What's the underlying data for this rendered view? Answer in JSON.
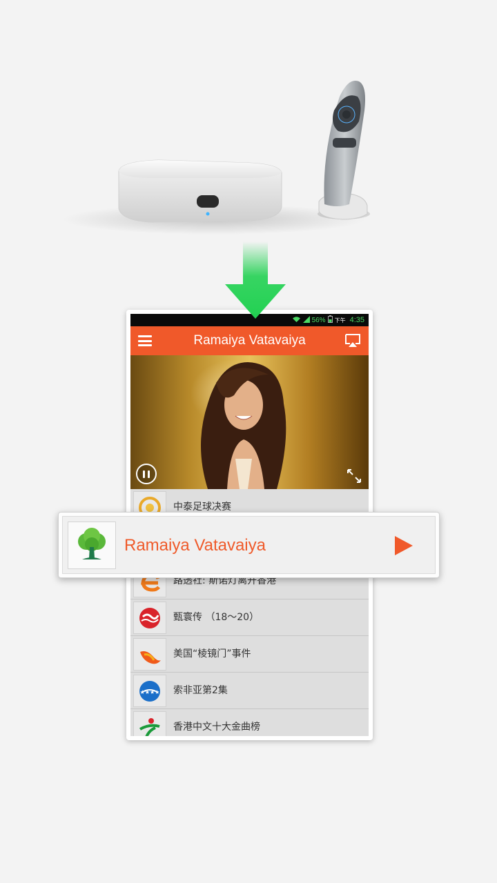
{
  "status_bar": {
    "battery_percent": "56%",
    "period": "下午",
    "time": "4:35"
  },
  "app_bar": {
    "title": "Ramaiya Vatavaiya"
  },
  "list": {
    "items": [
      {
        "label": "中泰足球决赛",
        "icon": "gold-swirl-logo-icon"
      },
      {
        "label": "路透社: 斯诺灯离开香港",
        "icon": "orange-e-logo-icon"
      },
      {
        "label": "甄寰传 （18～20）",
        "icon": "red-wave-logo-icon"
      },
      {
        "label": "美国“棱镜门”事件",
        "icon": "flame-logo-icon"
      },
      {
        "label": "索非亚第2集",
        "icon": "blue-stars-logo-icon"
      },
      {
        "label": "香港中文十大金曲榜",
        "icon": "green-red-figure-logo-icon"
      }
    ]
  },
  "popup": {
    "title": "Ramaiya Vatavaiya",
    "icon": "tree-icon"
  },
  "colors": {
    "accent": "#f0592a",
    "arrow": "#22d152",
    "popup_title": "#ef5a2a"
  }
}
